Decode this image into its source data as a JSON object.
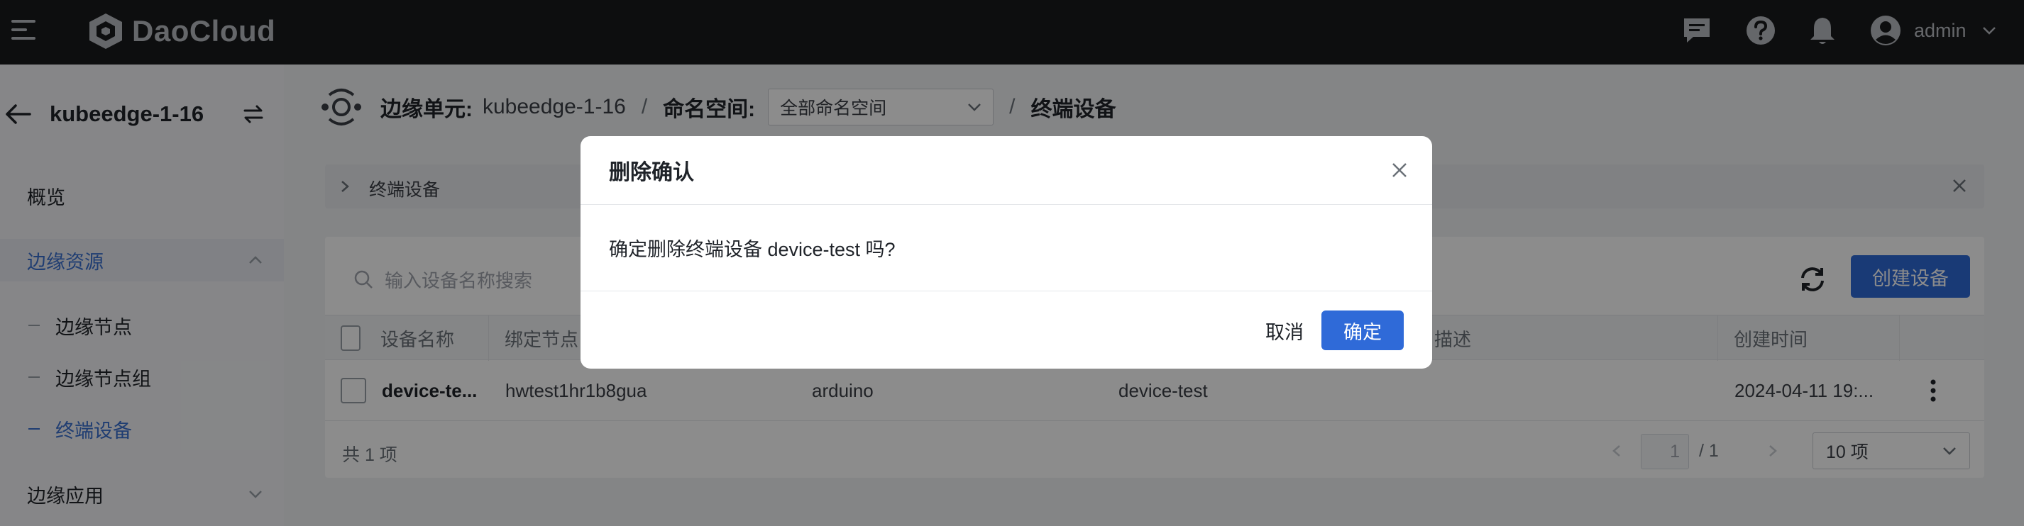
{
  "topbar": {
    "brand": "DaoCloud",
    "username": "admin",
    "icons": [
      "message-icon",
      "help-icon",
      "bell-icon",
      "avatar-icon"
    ]
  },
  "sidebar": {
    "cluster": "kubeedge-1-16",
    "items": [
      {
        "label": "概览"
      },
      {
        "label": "边缘资源",
        "expanded": true
      },
      {
        "label": "边缘节点"
      },
      {
        "label": "边缘节点组"
      },
      {
        "label": "终端设备",
        "active": true
      },
      {
        "label": "边缘应用"
      }
    ]
  },
  "breadcrumb": {
    "unit_key": "边缘单元:",
    "unit_value": "kubeedge-1-16",
    "sep": "/",
    "ns_key": "命名空间:",
    "ns_value": "全部命名空间",
    "current": "终端设备"
  },
  "info_bar": {
    "text": "终端设备"
  },
  "toolbar": {
    "search_placeholder": "输入设备名称搜索",
    "create_label": "创建设备"
  },
  "table": {
    "columns": [
      "设备名称",
      "绑定节点",
      "",
      "",
      "描述",
      "创建时间"
    ],
    "rows": [
      {
        "name": "device-te...",
        "node": "hwtest1hr1b8gua",
        "col3": "arduino",
        "col4": "device-test",
        "desc": "",
        "created": "2024-04-11 19:..."
      }
    ]
  },
  "footer": {
    "total": "共 1 项",
    "page": "1",
    "page_total": "/ 1",
    "page_size": "10 项"
  },
  "modal": {
    "title": "删除确认",
    "body": "确定删除终端设备 device-test 吗?",
    "cancel_label": "取消",
    "ok_label": "确定"
  },
  "colors": {
    "accent": "#2f6ad8",
    "topbar": "#191a1d",
    "active_text": "#3a6fcf"
  }
}
